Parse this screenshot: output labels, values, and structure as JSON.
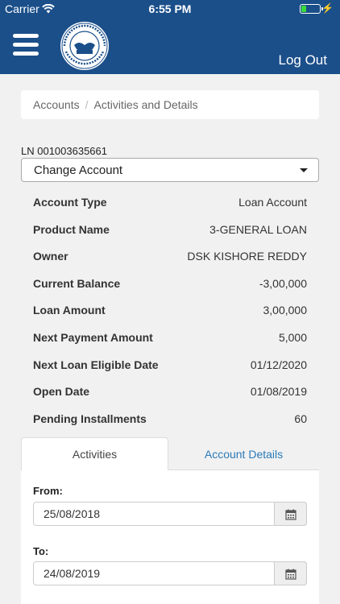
{
  "status_bar": {
    "carrier": "Carrier",
    "time": "6:55 PM"
  },
  "header": {
    "logout_label": "Log Out"
  },
  "breadcrumb": {
    "items": [
      "Accounts",
      "Activities and Details"
    ],
    "separator": "/"
  },
  "account": {
    "number_label": "LN 001003635661",
    "change_account_label": "Change Account"
  },
  "details": [
    {
      "label": "Account Type",
      "value": "Loan Account"
    },
    {
      "label": "Product Name",
      "value": "3-GENERAL LOAN"
    },
    {
      "label": "Owner",
      "value": "DSK KISHORE REDDY"
    },
    {
      "label": "Current Balance",
      "value": "-3,00,000"
    },
    {
      "label": "Loan Amount",
      "value": "3,00,000"
    },
    {
      "label": "Next Payment Amount",
      "value": "5,000"
    },
    {
      "label": "Next Loan Eligible Date",
      "value": "01/12/2020"
    },
    {
      "label": "Open Date",
      "value": "01/08/2019"
    },
    {
      "label": "Pending Installments",
      "value": "60"
    }
  ],
  "tabs": [
    {
      "label": "Activities",
      "active": true
    },
    {
      "label": "Account Details",
      "active": false
    }
  ],
  "filters": {
    "from_label": "From:",
    "from_value": "25/08/2018",
    "to_label": "To:",
    "to_value": "24/08/2019"
  },
  "colors": {
    "header_bg": "#1b4f8a",
    "link": "#2a7ab8",
    "battery": "#3adc3a"
  },
  "icons": [
    "wifi-icon",
    "battery-icon",
    "charging-icon",
    "menu-icon",
    "calendar-icon",
    "caret-down-icon"
  ]
}
